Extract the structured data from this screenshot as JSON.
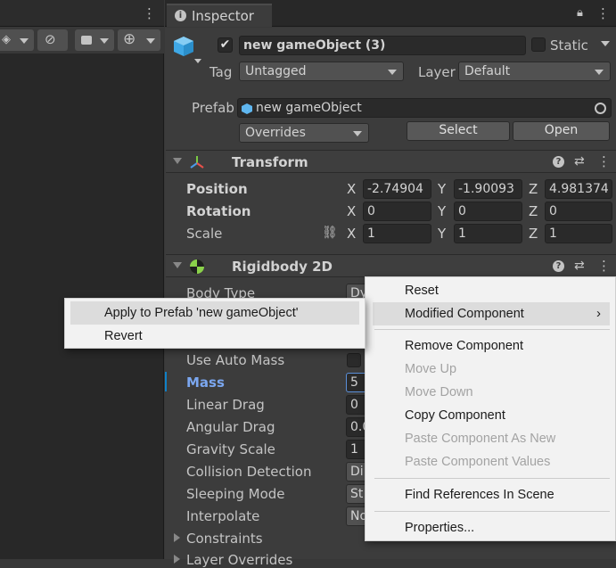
{
  "left_panel": {
    "toolbar": {
      "layers_icon": "layers-icon",
      "visibility_icon": "eye-slash-icon",
      "camera_icon": "camera-icon",
      "gizmo_icon": "gizmo-globe-icon"
    }
  },
  "inspector": {
    "tab_label": "Inspector",
    "object": {
      "enabled": true,
      "name": "new gameObject (3)",
      "static_label": "Static",
      "static_checked": false,
      "tag_label": "Tag",
      "tag_value": "Untagged",
      "layer_label": "Layer",
      "layer_value": "Default",
      "prefab_label": "Prefab",
      "prefab_value": "new gameObject",
      "overrides_value": "Overrides",
      "select_label": "Select",
      "open_label": "Open"
    },
    "transform": {
      "title": "Transform",
      "position": {
        "label": "Position",
        "x": "-2.74904",
        "y": "-1.90093",
        "z": "4.981374"
      },
      "rotation": {
        "label": "Rotation",
        "x": "0",
        "y": "0",
        "z": "0"
      },
      "scale": {
        "label": "Scale",
        "x": "1",
        "y": "1",
        "z": "1"
      },
      "axis_x": "X",
      "axis_y": "Y",
      "axis_z": "Z"
    },
    "rigidbody": {
      "title": "Rigidbody 2D",
      "body_type": {
        "label": "Body Type",
        "value": "Dy"
      },
      "use_auto_mass": {
        "label": "Use Auto Mass"
      },
      "mass": {
        "label": "Mass",
        "value": "5"
      },
      "linear_drag": {
        "label": "Linear Drag",
        "value": "0"
      },
      "angular_drag": {
        "label": "Angular Drag",
        "value": "0.0"
      },
      "gravity_scale": {
        "label": "Gravity Scale",
        "value": "1"
      },
      "collision_detection": {
        "label": "Collision Detection",
        "value": "Di"
      },
      "sleeping_mode": {
        "label": "Sleeping Mode",
        "value": "St"
      },
      "interpolate": {
        "label": "Interpolate",
        "value": "No"
      },
      "constraints": {
        "label": "Constraints"
      },
      "layer_overrides": {
        "label": "Layer Overrides"
      }
    }
  },
  "context_menu": {
    "reset": "Reset",
    "modified_component": "Modified Component",
    "remove_component": "Remove Component",
    "move_up": "Move Up",
    "move_down": "Move Down",
    "copy_component": "Copy Component",
    "paste_as_new": "Paste Component As New",
    "paste_values": "Paste Component Values",
    "find_references": "Find References In Scene",
    "properties": "Properties..."
  },
  "submenu": {
    "apply": "Apply to Prefab 'new gameObject'",
    "revert": "Revert"
  },
  "colors": {
    "panel_bg": "#383838",
    "accent_blue": "#7ba7f0",
    "menu_bg": "#f2f2f2",
    "menu_highlight": "#dcdcdc",
    "disabled_text": "#a3a3a3"
  }
}
